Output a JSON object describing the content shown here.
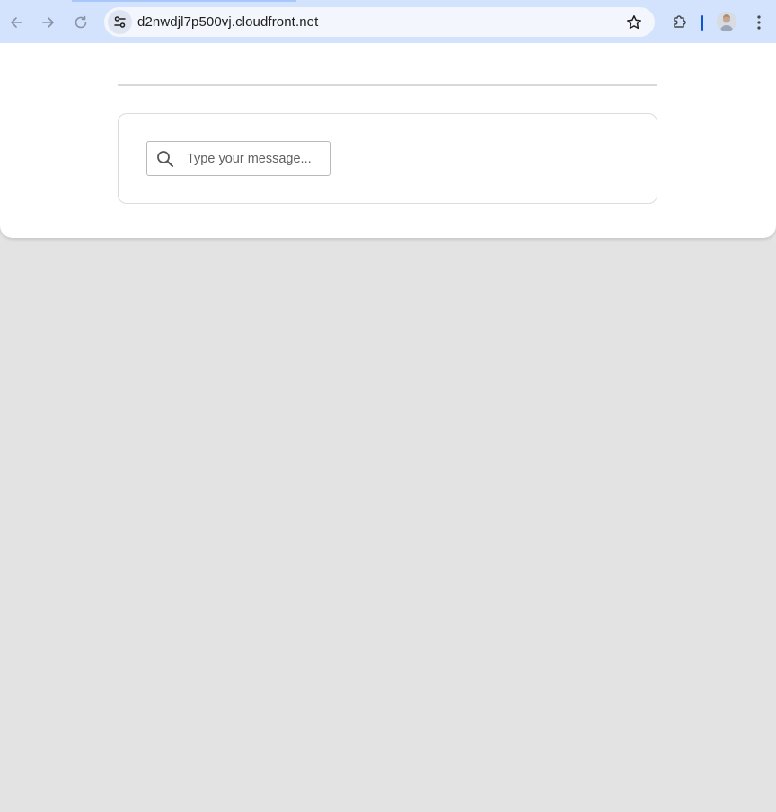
{
  "browser": {
    "url": "d2nwdjl7p500vj.cloudfront.net",
    "back_icon": "arrow-left-icon",
    "forward_icon": "arrow-right-icon",
    "reload_icon": "reload-icon",
    "site_info_icon": "tune-icon",
    "bookmark_icon": "star-icon",
    "extensions_icon": "puzzle-icon",
    "menu_icon": "kebab-icon",
    "accent_color": "#d3e3fd"
  },
  "page": {
    "search": {
      "placeholder": "Type your message...",
      "value": "",
      "icon": "search-icon"
    }
  }
}
